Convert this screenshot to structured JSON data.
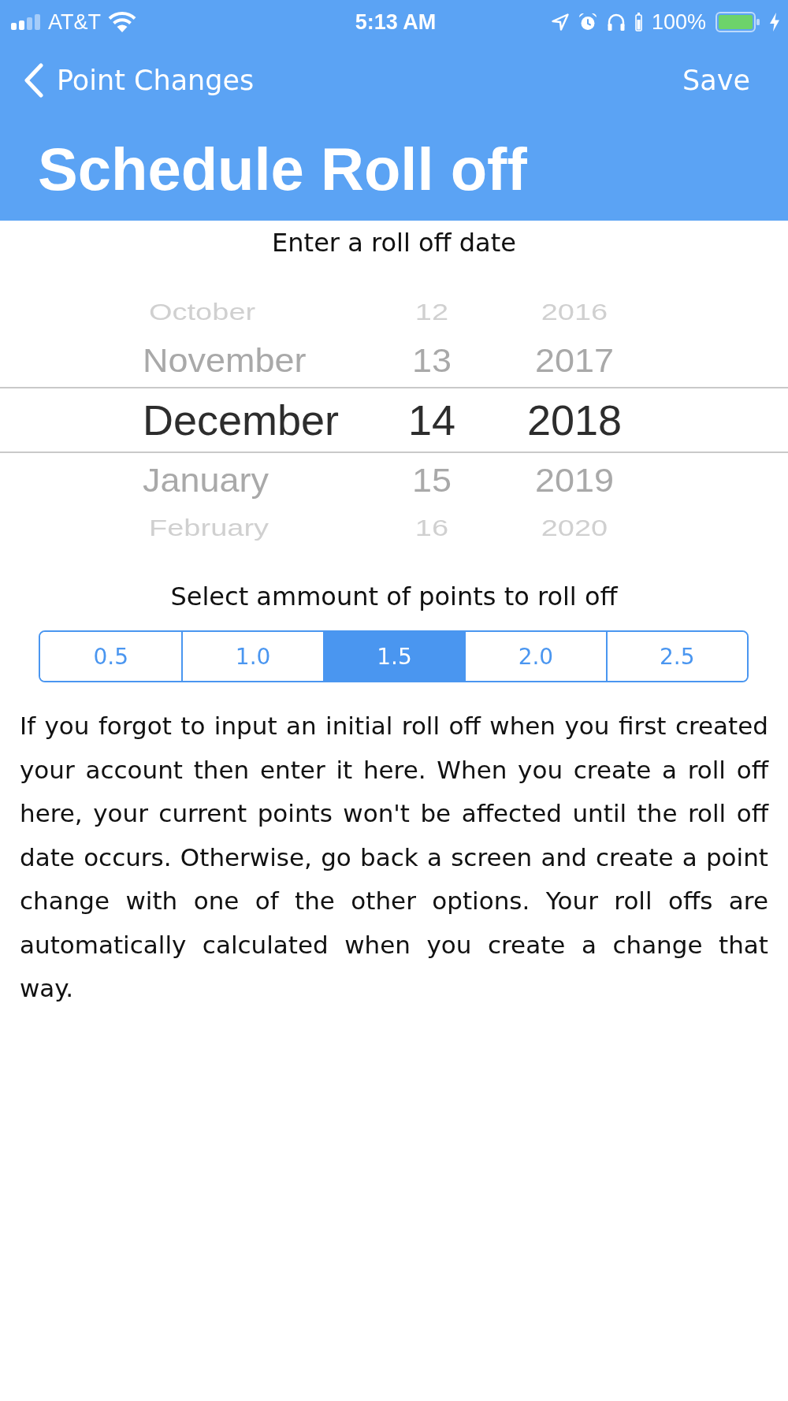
{
  "status_bar": {
    "carrier": "AT&T",
    "time": "5:13 AM",
    "battery": "100%"
  },
  "nav": {
    "back": "Point Changes",
    "action": "Save",
    "title": "Schedule Roll off"
  },
  "date_prompt": "Enter a roll off date",
  "picker": {
    "columns": [
      {
        "kind": "month",
        "items": [
          {
            "label": "October",
            "selected": false
          },
          {
            "label": "November",
            "selected": false
          },
          {
            "label": "December",
            "selected": true
          },
          {
            "label": "January",
            "selected": false
          },
          {
            "label": "February",
            "selected": false
          }
        ]
      },
      {
        "kind": "day",
        "items": [
          {
            "label": "12",
            "selected": false
          },
          {
            "label": "13",
            "selected": false
          },
          {
            "label": "14",
            "selected": true
          },
          {
            "label": "15",
            "selected": false
          },
          {
            "label": "16",
            "selected": false
          }
        ]
      },
      {
        "kind": "year",
        "items": [
          {
            "label": "2016",
            "selected": false
          },
          {
            "label": "2017",
            "selected": false
          },
          {
            "label": "2018",
            "selected": true
          },
          {
            "label": "2019",
            "selected": false
          },
          {
            "label": "2020",
            "selected": false
          }
        ]
      }
    ]
  },
  "points": {
    "prompt": "Select ammount of points to roll off",
    "options": [
      {
        "label": "0.5",
        "selected": false
      },
      {
        "label": "1.0",
        "selected": false
      },
      {
        "label": "1.5",
        "selected": true
      },
      {
        "label": "2.0",
        "selected": false
      },
      {
        "label": "2.5",
        "selected": false
      }
    ]
  },
  "help_text": "If you forgot to input an initial roll off when you first created your account then enter it here. When you create a roll off here, your current points won't be affected until the roll off date occurs. Otherwise, go back a screen and create a point change with one of the other options. Your roll offs are automatically calculated when you create a change that way."
}
